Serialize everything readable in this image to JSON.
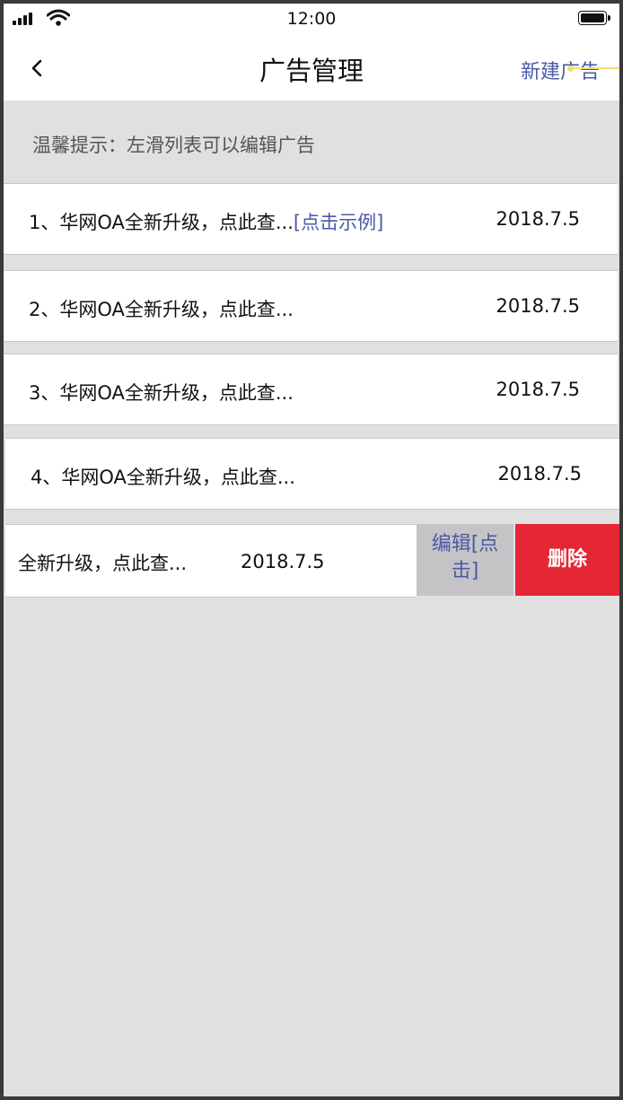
{
  "status_bar": {
    "time": "12:00"
  },
  "header": {
    "title": "广告管理",
    "new_button": "新建广告"
  },
  "tip": "温馨提示：左滑列表可以编辑广告",
  "ads": [
    {
      "text": "1、华网OA全新升级，点此查...",
      "link": "[点击示例]",
      "date": "2018.7.5"
    },
    {
      "text": "2、华网OA全新升级，点此查...",
      "date": "2018.7.5"
    },
    {
      "text": "3、华网OA全新升级，点此查...",
      "date": "2018.7.5"
    },
    {
      "text": "4、华网OA全新升级，点此查...",
      "date": "2018.7.5"
    }
  ],
  "swiped_row": {
    "text": "全新升级，点此查...",
    "date": "2018.7.5",
    "edit_label_1": "编辑[点",
    "edit_label_2": "击]",
    "delete_label": "删除"
  }
}
